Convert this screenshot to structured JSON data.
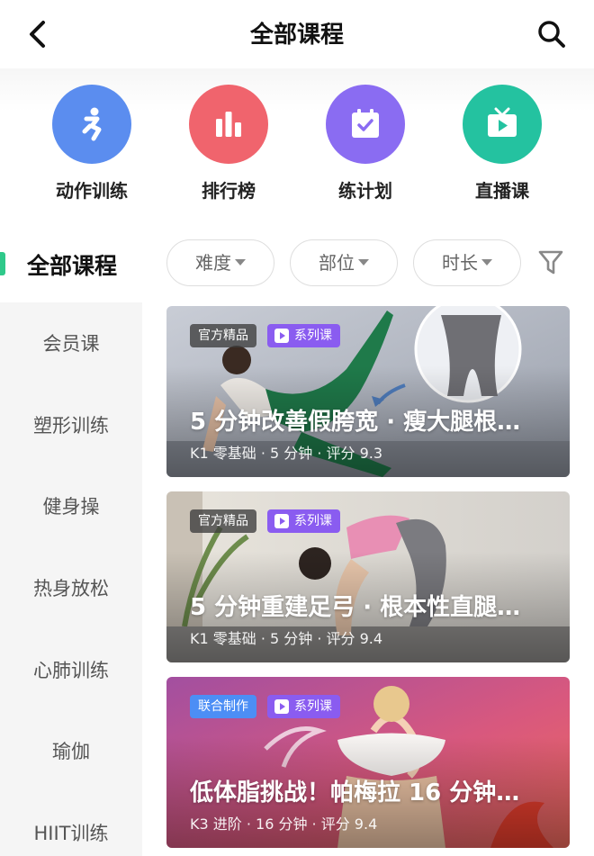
{
  "header": {
    "title": "全部课程"
  },
  "quick_entries": [
    {
      "label": "动作训练",
      "icon": "runner-icon",
      "color": "#5b8def"
    },
    {
      "label": "排行榜",
      "icon": "bar-chart-icon",
      "color": "#f0646d"
    },
    {
      "label": "练计划",
      "icon": "calendar-check-icon",
      "color": "#8a6cf2"
    },
    {
      "label": "直播课",
      "icon": "tv-play-icon",
      "color": "#24c2a0"
    }
  ],
  "filter": {
    "active_category": "全部课程",
    "chips": [
      "难度",
      "部位",
      "时长"
    ],
    "accent": "#2fc98a"
  },
  "sidebar": {
    "items": [
      "会员课",
      "塑形训练",
      "健身操",
      "热身放松",
      "心肺训练",
      "瑜伽",
      "HIIT训练"
    ]
  },
  "courses": [
    {
      "tag": "官方精品",
      "series_tag": "系列课",
      "title": "5 分钟改善假胯宽 · 瘦大腿根…",
      "meta": "K1 零基础 · 5 分钟 · 评分 9.3"
    },
    {
      "tag": "官方精品",
      "series_tag": "系列课",
      "title": "5 分钟重建足弓 · 根本性直腿…",
      "meta": "K1 零基础 · 5 分钟 · 评分 9.4"
    },
    {
      "tag": "联合制作",
      "series_tag": "系列课",
      "title": "低体脂挑战！帕梅拉 16 分钟…",
      "meta": "K3 进阶 · 16 分钟 · 评分 9.4"
    }
  ]
}
